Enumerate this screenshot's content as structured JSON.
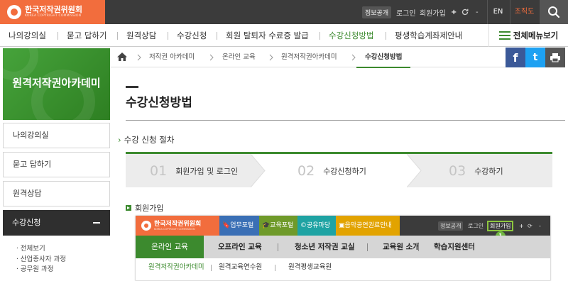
{
  "brand": {
    "name_ko": "한국저작권위원회",
    "name_en": "KOREA COPYRIGHT COMMISSION",
    "color": "#f26d3d"
  },
  "utility": {
    "info_open": "정보공개",
    "login": "로그인",
    "join": "회원가입",
    "plus": "+",
    "minus": "-",
    "lang": "EN",
    "org_chart": "조직도",
    "search_icon": "search-icon"
  },
  "gnb": {
    "items": [
      "나의강의실",
      "묻고 답하기",
      "원격상담",
      "수강신청",
      "회원 탈퇴자 수료증 발급",
      "수강신청방법",
      "평생학습계좌제안내"
    ],
    "active_index": 5,
    "all_menu": "전체메뉴보기"
  },
  "sidebar": {
    "banner_title": "원격저작권아카데미",
    "items": [
      "나의강의실",
      "묻고 답하기",
      "원격상담"
    ],
    "active": "수강신청",
    "sub_items": [
      "전체보기",
      "산업종사자 과정",
      "공무원 과정"
    ]
  },
  "breadcrumb": {
    "items": [
      "저작권 아카데미",
      "온라인 교육",
      "원격저작권아카데미",
      "수강신청방법"
    ]
  },
  "share": {
    "facebook": "f",
    "twitter": "t"
  },
  "content": {
    "page_title": "수강신청방법",
    "section_title": "수강 신청 절차",
    "steps": [
      {
        "num": "01",
        "label": "회원가입 및 로그인"
      },
      {
        "num": "02",
        "label": "수강신청하기"
      },
      {
        "num": "03",
        "label": "수강하기"
      }
    ],
    "sub_title": "회원가입"
  },
  "example": {
    "tabs": [
      "업무포털",
      "교육포털",
      "공유마당",
      "음악공연권료안내"
    ],
    "tab_colors": [
      "#3a6fb5",
      "#6f9a2a",
      "#1ea3a3",
      "#e2a300"
    ],
    "util": [
      "정보공개",
      "로그인",
      "회원가입",
      "+",
      "-"
    ],
    "badge": "1",
    "gnb": [
      "온라인 교육",
      "오프라인 교육",
      "청소년 저작권 교실",
      "교육원 소개",
      "학습지원센터"
    ],
    "sub": [
      "원격저작권아카데미",
      "원격교육연수원",
      "원격평생교육원"
    ]
  },
  "colors": {
    "accent_green": "#3c8a2e",
    "dark_bar": "#3b3b3b",
    "facebook": "#3b5998",
    "twitter": "#1da1f2",
    "print": "#555555"
  }
}
